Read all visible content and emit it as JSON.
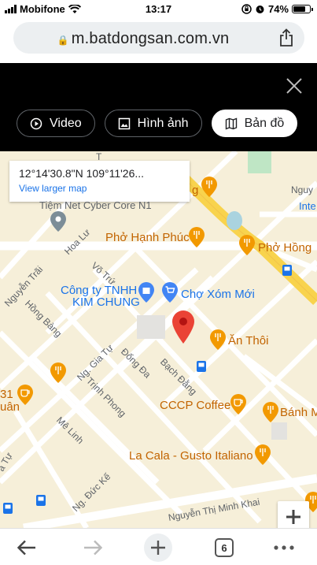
{
  "status_bar": {
    "carrier": "Mobifone",
    "time": "13:17",
    "battery": "74%",
    "battery_level": 0.74
  },
  "browser": {
    "url": "m.batdongsan.com.vn",
    "tab_count": "6"
  },
  "gallery": {
    "tabs": [
      {
        "label": "Video",
        "icon": "play-circle-icon",
        "active": false
      },
      {
        "label": "Hình ảnh",
        "icon": "image-icon",
        "active": false
      },
      {
        "label": "Bản đồ",
        "icon": "map-icon",
        "active": true
      }
    ]
  },
  "map": {
    "coordinates": "12°14'30.8\"N 109°11'26...",
    "larger_map_link": "View larger map",
    "places": {
      "pho_hanh_phuc": "Phở Hạnh Phúc",
      "pho_hong": "Phở Hồng",
      "cong_ty": "Công ty TNHH",
      "kim_chung": "KIM CHUNG",
      "cho_xom_moi": "Chợ Xóm Mới",
      "an_thoi": "Ăn Thôi",
      "cccp_coffee": "CCCP Coffee",
      "banh_m": "Bánh M",
      "la_cala": "La Cala - Gusto Italiano",
      "tiem_net": "Tiệm Net Cyber Core N1",
      "inter": "Inte",
      "nguy": "Nguy",
      "ng_31": "31",
      "ng_uan": "uân",
      "ng_g": "g",
      "ng_t": "T"
    },
    "streets": {
      "hoa_lu": "Hoa Lư",
      "vo_tru": "Võ Trứ",
      "nguyen_trai": "Nguyễn Trãi",
      "hong_bang": "Hồng Bàng",
      "ng_gia_tu": "Ng. Gia Tự",
      "dong_da": "Đống Đa",
      "bach_dang": "Bạch Đằng",
      "trinh_phong": "Trịnh Phong",
      "me_linh": "Mê Linh",
      "ng_duc_ke": "Ng. Đức Kế",
      "nguyen_thi_minh_khai": "Nguyễn Thị Minh Khai",
      "a_tu": "a Tự"
    }
  },
  "colors": {
    "map_bg": "#f6efd9",
    "highway": "#f8d34d",
    "pin_red": "#ea4335",
    "poi_orange": "#f29900",
    "link_blue": "#1a73e8"
  }
}
